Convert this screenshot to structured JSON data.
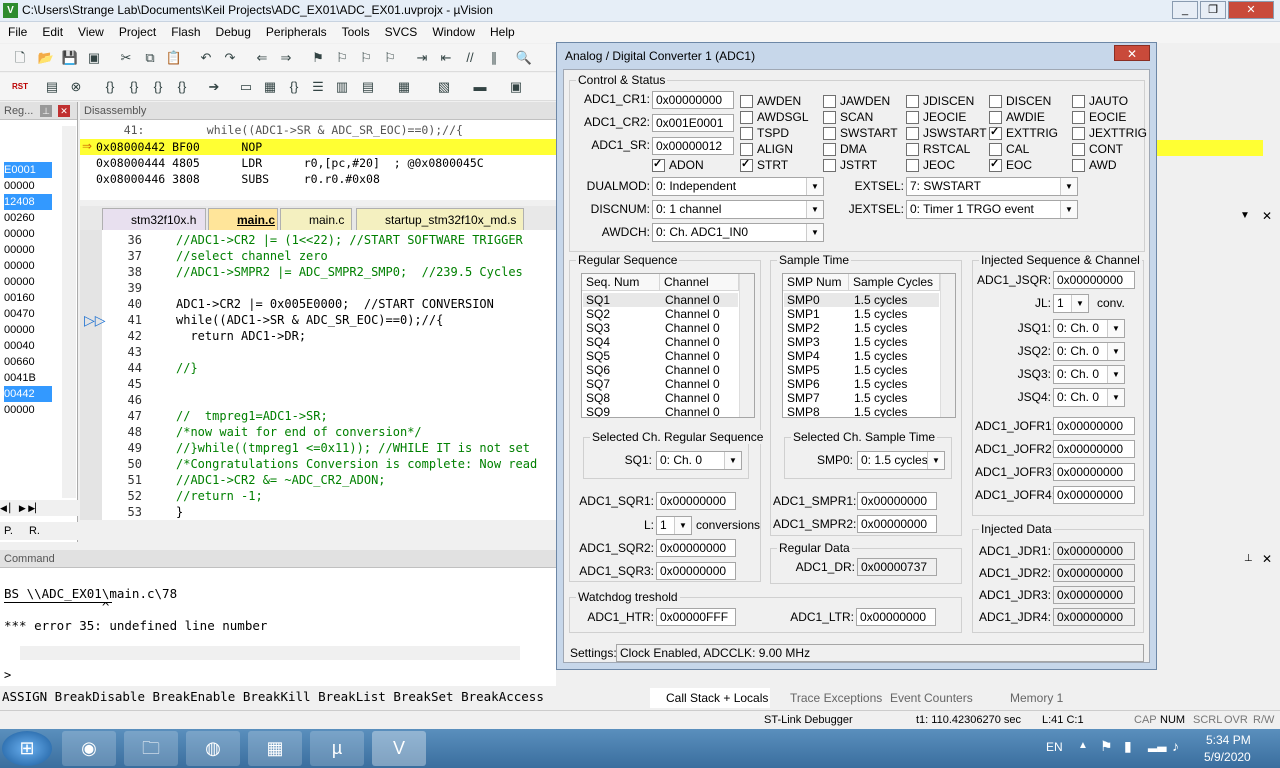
{
  "window": {
    "title": "C:\\Users\\Strange Lab\\Documents\\Keil Projects\\ADC_EX01\\ADC_EX01.uvprojx - µVision",
    "icon": "V"
  },
  "menu": [
    "File",
    "Edit",
    "View",
    "Project",
    "Flash",
    "Debug",
    "Peripherals",
    "Tools",
    "SVCS",
    "Window",
    "Help"
  ],
  "regpanel": {
    "title": "Reg...",
    "values": [
      "E0001",
      "00000",
      "12408",
      "00260",
      "00000",
      "00000",
      "00000",
      "00000",
      "00160",
      "00470",
      "00000",
      "00040",
      "00660",
      "0041B",
      "00442",
      "00000"
    ],
    "selected": [
      0,
      2,
      14
    ]
  },
  "disassembly": {
    "title": "Disassembly",
    "lines": [
      "    41:         while((ADC1->SR & ADC_SR_EOC)==0);//{",
      "0x08000442 BF00      NOP",
      "0x08000444 4805      LDR      r0,[pc,#20]  ; @0x0800045C",
      "0x08000446 3808      SUBS     r0,r0,#0x08"
    ]
  },
  "editor_tabs": [
    "stm32f10x.h",
    "main.c",
    "main.c",
    "startup_stm32f10x_md.s"
  ],
  "editor": {
    "lines": [
      {
        "n": "36",
        "t": "//ADC1->CR2 |= (1<<22); //START SOFTWARE TRIGGER"
      },
      {
        "n": "37",
        "t": "//select channel zero"
      },
      {
        "n": "38",
        "t": "//ADC1->SMPR2 |= ADC_SMPR2_SMP0;  //239.5 Cycles"
      },
      {
        "n": "39",
        "t": ""
      },
      {
        "n": "40",
        "t": "ADC1->CR2 |= 0x005E0000;  //START CONVERSION"
      },
      {
        "n": "41",
        "t": "while((ADC1->SR & ADC_SR_EOC)==0);//{"
      },
      {
        "n": "42",
        "t": "  return ADC1->DR;"
      },
      {
        "n": "43",
        "t": ""
      },
      {
        "n": "44",
        "t": "//}"
      },
      {
        "n": "45",
        "t": ""
      },
      {
        "n": "46",
        "t": ""
      },
      {
        "n": "47",
        "t": "//  tmpreg1=ADC1->SR;"
      },
      {
        "n": "48",
        "t": "/*now wait for end of conversion*/"
      },
      {
        "n": "49",
        "t": "//}while((tmpreg1 <=0x11)); //WHILE IT is not set"
      },
      {
        "n": "50",
        "t": "/*Congratulations Conversion is complete: Now read"
      },
      {
        "n": "51",
        "t": "//ADC1->CR2 &= ~ADC_CR2_ADON;"
      },
      {
        "n": "52",
        "t": "//return -1;"
      },
      {
        "n": "53",
        "t": "}"
      }
    ]
  },
  "left_tabs": [
    "P.",
    "R."
  ],
  "command": {
    "title": "Command",
    "lines": [
      "BS \\\\ADC_EX01\\main.c\\78",
      "             ^",
      "*** error 35: undefined line number"
    ],
    "prompt": ">",
    "hint": "ASSIGN BreakDisable BreakEnable BreakKill BreakList BreakSet BreakAccess"
  },
  "bottom_tabs": [
    "Call Stack + Locals",
    "Trace Exceptions",
    "Event Counters",
    "Memory 1"
  ],
  "status": {
    "debugger": "ST-Link Debugger",
    "time": "t1: 110.42306270 sec",
    "pos": "L:41 C:1",
    "flags": [
      "CAP",
      "NUM",
      "SCRL",
      "OVR",
      "R/W"
    ]
  },
  "taskbar": {
    "lang": "EN",
    "time": "5:34 PM",
    "date": "5/9/2020"
  },
  "dialog": {
    "title": "Analog / Digital Converter 1 (ADC1)",
    "control": {
      "title": "Control & Status",
      "cr1_label": "ADC1_CR1:",
      "cr1": "0x00000000",
      "cr2_label": "ADC1_CR2:",
      "cr2": "0x001E0001",
      "sr_label": "ADC1_SR:",
      "sr": "0x00000012",
      "checks": [
        {
          "l": "AWDEN",
          "on": false
        },
        {
          "l": "JAWDEN",
          "on": false
        },
        {
          "l": "JDISCEN",
          "on": false
        },
        {
          "l": "DISCEN",
          "on": false
        },
        {
          "l": "JAUTO",
          "on": false
        },
        {
          "l": "AWDSGL",
          "on": false
        },
        {
          "l": "SCAN",
          "on": false
        },
        {
          "l": "JEOCIE",
          "on": false
        },
        {
          "l": "AWDIE",
          "on": false
        },
        {
          "l": "EOCIE",
          "on": false
        },
        {
          "l": "TSPD",
          "on": false
        },
        {
          "l": "SWSTART",
          "on": false
        },
        {
          "l": "JSWSTART",
          "on": false
        },
        {
          "l": "EXTTRIG",
          "on": true
        },
        {
          "l": "JEXTTRIG",
          "on": false
        },
        {
          "l": "ALIGN",
          "on": false
        },
        {
          "l": "DMA",
          "on": false
        },
        {
          "l": "RSTCAL",
          "on": false
        },
        {
          "l": "CAL",
          "on": false
        },
        {
          "l": "CONT",
          "on": false
        },
        {
          "l": "ADON",
          "on": true
        },
        {
          "l": "STRT",
          "on": true
        },
        {
          "l": "JSTRT",
          "on": false
        },
        {
          "l": "JEOC",
          "on": false
        },
        {
          "l": "EOC",
          "on": true
        },
        {
          "l": "AWD",
          "on": false
        }
      ],
      "dualmod_label": "DUALMOD:",
      "dualmod": "0: Independent",
      "discnum_label": "DISCNUM:",
      "discnum": "0: 1 channel",
      "awdch_label": "AWDCH:",
      "awdch": "0: Ch. ADC1_IN0",
      "extsel_label": "EXTSEL:",
      "extsel": "7: SWSTART",
      "jextsel_label": "JEXTSEL:",
      "jextsel": "0: Timer 1 TRGO event"
    },
    "regular": {
      "title": "Regular Sequence",
      "h1": "Seq. Num",
      "h2": "Channel",
      "rows": [
        [
          "SQ1",
          "Channel 0"
        ],
        [
          "SQ2",
          "Channel 0"
        ],
        [
          "SQ3",
          "Channel 0"
        ],
        [
          "SQ4",
          "Channel 0"
        ],
        [
          "SQ5",
          "Channel 0"
        ],
        [
          "SQ6",
          "Channel 0"
        ],
        [
          "SQ7",
          "Channel 0"
        ],
        [
          "SQ8",
          "Channel 0"
        ],
        [
          "SQ9",
          "Channel 0"
        ]
      ],
      "sel_title": "Selected Ch. Regular Sequence",
      "sel_label": "SQ1:",
      "sel": "0: Ch. 0",
      "sqr1_label": "ADC1_SQR1:",
      "sqr1": "0x00000000",
      "l_label": "L:",
      "l": "1",
      "conv": "conversions",
      "sqr2_label": "ADC1_SQR2:",
      "sqr2": "0x00000000",
      "sqr3_label": "ADC1_SQR3:",
      "sqr3": "0x00000000"
    },
    "sample": {
      "title": "Sample Time",
      "h1": "SMP Num",
      "h2": "Sample Cycles",
      "rows": [
        [
          "SMP0",
          "1.5 cycles"
        ],
        [
          "SMP1",
          "1.5 cycles"
        ],
        [
          "SMP2",
          "1.5 cycles"
        ],
        [
          "SMP3",
          "1.5 cycles"
        ],
        [
          "SMP4",
          "1.5 cycles"
        ],
        [
          "SMP5",
          "1.5 cycles"
        ],
        [
          "SMP6",
          "1.5 cycles"
        ],
        [
          "SMP7",
          "1.5 cycles"
        ],
        [
          "SMP8",
          "1.5 cycles"
        ]
      ],
      "sel_title": "Selected Ch. Sample Time",
      "sel_label": "SMP0:",
      "sel": "0: 1.5 cycles",
      "smpr1_label": "ADC1_SMPR1:",
      "smpr1": "0x00000000",
      "smpr2_label": "ADC1_SMPR2:",
      "smpr2": "0x00000000"
    },
    "regdata": {
      "title": "Regular Data",
      "dr_label": "ADC1_DR:",
      "dr": "0x00000737"
    },
    "injected": {
      "title": "Injected Sequence & Channel",
      "jsqr_label": "ADC1_JSQR:",
      "jsqr": "0x00000000",
      "jl_label": "JL:",
      "jl": "1",
      "conv": "conv.",
      "jsq": [
        {
          "l": "JSQ1:",
          "v": "0: Ch. 0"
        },
        {
          "l": "JSQ2:",
          "v": "0: Ch. 0"
        },
        {
          "l": "JSQ3:",
          "v": "0: Ch. 0"
        },
        {
          "l": "JSQ4:",
          "v": "0: Ch. 0"
        }
      ],
      "jofr": [
        {
          "l": "ADC1_JOFR1:",
          "v": "0x00000000"
        },
        {
          "l": "ADC1_JOFR2:",
          "v": "0x00000000"
        },
        {
          "l": "ADC1_JOFR3:",
          "v": "0x00000000"
        },
        {
          "l": "ADC1_JOFR4:",
          "v": "0x00000000"
        }
      ]
    },
    "injdata": {
      "title": "Injected Data",
      "jdr": [
        {
          "l": "ADC1_JDR1:",
          "v": "0x00000000"
        },
        {
          "l": "ADC1_JDR2:",
          "v": "0x00000000"
        },
        {
          "l": "ADC1_JDR3:",
          "v": "0x00000000"
        },
        {
          "l": "ADC1_JDR4:",
          "v": "0x00000000"
        }
      ]
    },
    "watchdog": {
      "title": "Watchdog treshold",
      "htr_label": "ADC1_HTR:",
      "htr": "0x00000FFF",
      "ltr_label": "ADC1_LTR:",
      "ltr": "0x00000000"
    },
    "settings_label": "Settings:",
    "settings": "Clock Enabled, ADCCLK: 9.00 MHz"
  }
}
